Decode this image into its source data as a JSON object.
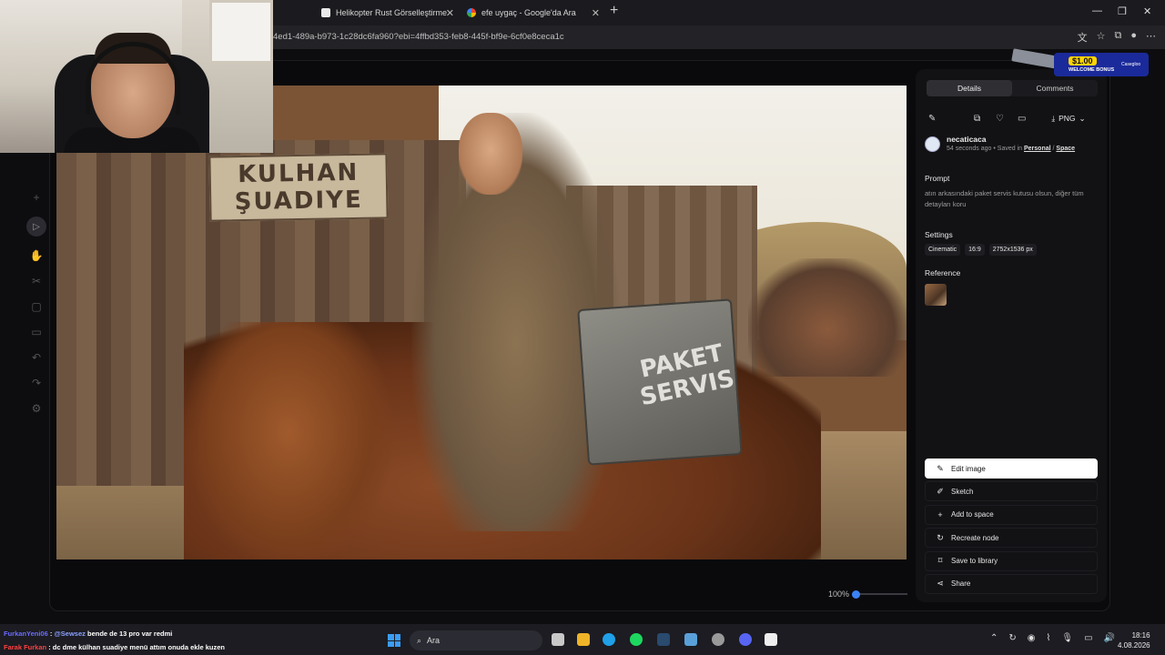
{
  "browser": {
    "tabs": [
      {
        "title": "Helikopter Rust Görselleştirme"
      },
      {
        "title": "efe uygaç - Google'da Ara"
      }
    ],
    "url": "4ed1-489a-b973-1c28dc6fa960?ebi=4ffbd353-feb8-445f-bf9e-6cf0e8ceca1c"
  },
  "image": {
    "sign_line1": "KULHAN",
    "sign_line2": "ŞUADIYE",
    "box_line1": "PAKET",
    "box_line2": "SERVIS"
  },
  "zoom": {
    "level": "100%"
  },
  "panel": {
    "tabs": {
      "details": "Details",
      "comments": "Comments"
    },
    "download_format": "PNG",
    "user": {
      "name": "necaticaca",
      "time": "54 seconds ago",
      "saved_in": "Saved in",
      "folder": "Personal",
      "separator": "/",
      "space": "Space"
    },
    "prompt_label": "Prompt",
    "prompt_text": "atın arkasındaki paket servis kutusu olsun, diğer tüm detayları koru",
    "settings_label": "Settings",
    "settings": [
      "Cinematic",
      "16:9",
      "2752x1536 px"
    ],
    "reference_label": "Reference",
    "actions": [
      {
        "label": "Edit image",
        "icon": "edit-image-icon"
      },
      {
        "label": "Sketch",
        "icon": "brush-icon"
      },
      {
        "label": "Add to space",
        "icon": "plus-icon"
      },
      {
        "label": "Recreate node",
        "icon": "refresh-icon"
      },
      {
        "label": "Save to library",
        "icon": "bookmark-icon"
      },
      {
        "label": "Share",
        "icon": "share-icon"
      }
    ]
  },
  "promo": {
    "amount": "$1.00",
    "label": "WELCOME BONUS",
    "brand": "Casegloo"
  },
  "chat": [
    {
      "user": "FurkanYeni06",
      "sep": ":",
      "mention": "@Sewsez",
      "text": "bende de 13 pro var redmi"
    },
    {
      "user": "Farak Furkan",
      "sep": ":",
      "mention": "",
      "text": "dc dme külhan suadiye menü attım onuda ekle kuzen"
    }
  ],
  "taskbar": {
    "search_placeholder": "Ara",
    "time": "18:16",
    "date": "4.08.2026"
  },
  "colors": {
    "accent": "#3b82f6",
    "panel": "#121215",
    "primary_button": "#ffffff"
  }
}
